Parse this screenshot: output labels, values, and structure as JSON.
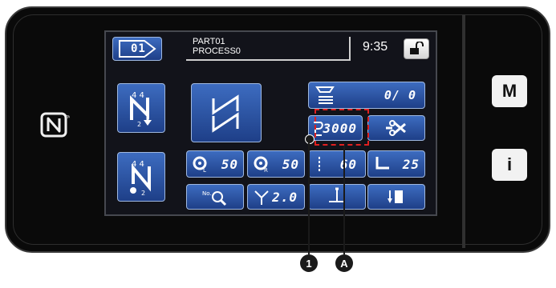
{
  "header": {
    "part_label": "PART01",
    "process_label": "PROCESS0",
    "time": "9:35",
    "pattern_number": "01"
  },
  "counter": {
    "value": "0/ 0"
  },
  "stitches": {
    "value": "3000"
  },
  "params": {
    "thread_tension_left": "50",
    "thread_tension_right": "50",
    "stitch_length": "60",
    "presser_foot": "25",
    "pitch": "2.0"
  },
  "side_buttons": {
    "menu": "M",
    "info": "i"
  },
  "callouts": {
    "marker_1": "1",
    "marker_a": "A"
  },
  "icons": [
    "nfc-icon",
    "pattern-number-icon",
    "unlock-icon",
    "counter-icon",
    "stitch-counter-icon",
    "thread-trim-icon",
    "tension-left-icon",
    "tension-right-icon",
    "stitch-length-icon",
    "presser-foot-icon",
    "search-icon",
    "pitch-icon",
    "needle-position-icon",
    "needle-down-icon",
    "sewing-start-icon",
    "sewing-end-icon",
    "zigzag-icon"
  ],
  "colors": {
    "button_blue": "#2a55a8",
    "callout_red": "#e02020",
    "screen_bg": "#12131a"
  }
}
